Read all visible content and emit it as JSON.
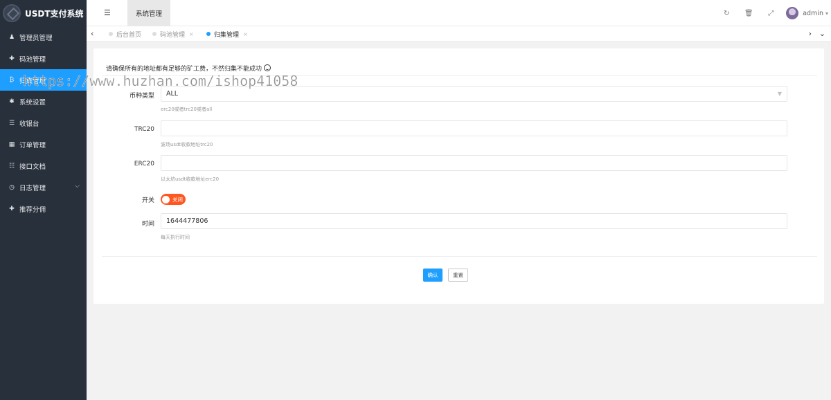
{
  "app": {
    "title": "USDT支付系统"
  },
  "sidebar": {
    "items": [
      {
        "label": "管理员管理",
        "icon": "user-icon",
        "glyph": "♟",
        "active": false
      },
      {
        "label": "码池管理",
        "icon": "plus-icon",
        "glyph": "✚",
        "active": false
      },
      {
        "label": "归集管理",
        "icon": "bitcoin-icon",
        "glyph": "₿",
        "active": true
      },
      {
        "label": "系统设置",
        "icon": "gear-icon",
        "glyph": "✱",
        "active": false
      },
      {
        "label": "收银台",
        "icon": "list-icon",
        "glyph": "☰",
        "active": false
      },
      {
        "label": "订单管理",
        "icon": "calculator-icon",
        "glyph": "▦",
        "active": false
      },
      {
        "label": "接口文档",
        "icon": "document-icon",
        "glyph": "☷",
        "active": false
      },
      {
        "label": "日志管理",
        "icon": "clock-icon",
        "glyph": "◷",
        "active": false,
        "caret": "⌵"
      },
      {
        "label": "推荐分佣",
        "icon": "plus-icon",
        "glyph": "✚",
        "active": false
      }
    ]
  },
  "topbar": {
    "menu_toggle_glyph": "☰",
    "tab_label": "系统管理",
    "tools": [
      {
        "icon": "refresh-icon",
        "glyph": "↻"
      },
      {
        "icon": "trash-icon",
        "glyph": "🗑"
      },
      {
        "icon": "fullscreen-icon",
        "glyph": "⤢"
      }
    ],
    "username": "admin",
    "user_caret": "▾"
  },
  "page_tabs": {
    "left_glyph": "‹",
    "right_glyph": "›",
    "down_glyph": "⌄",
    "tabs": [
      {
        "label": "后台首页",
        "closable": false,
        "active": false
      },
      {
        "label": "码池管理",
        "closable": true,
        "active": false
      },
      {
        "label": "归集管理",
        "closable": true,
        "active": true
      }
    ],
    "close_glyph": "×"
  },
  "form": {
    "notice": "请确保所有的地址都有足够的矿工费，不然归集不能成功",
    "currency": {
      "label": "币种类型",
      "value": "ALL",
      "help": "erc20或者trc20或者all"
    },
    "trc20": {
      "label": "TRC20",
      "value": "",
      "help": "波场usdt收款地址trc20"
    },
    "erc20": {
      "label": "ERC20",
      "value": "",
      "help": "以太坊usdt收款地址erc20"
    },
    "switch": {
      "label": "开关",
      "state_text": "关闭"
    },
    "time": {
      "label": "时间",
      "value": "1644477806",
      "help": "每天执行时间"
    },
    "confirm_label": "确认",
    "reset_label": "重置"
  },
  "watermark": "https://www.huzhan.com/ishop41058",
  "colors": {
    "sidebar_bg": "#28303c",
    "accent": "#1e9fff",
    "switch_off": "#ff5722"
  }
}
